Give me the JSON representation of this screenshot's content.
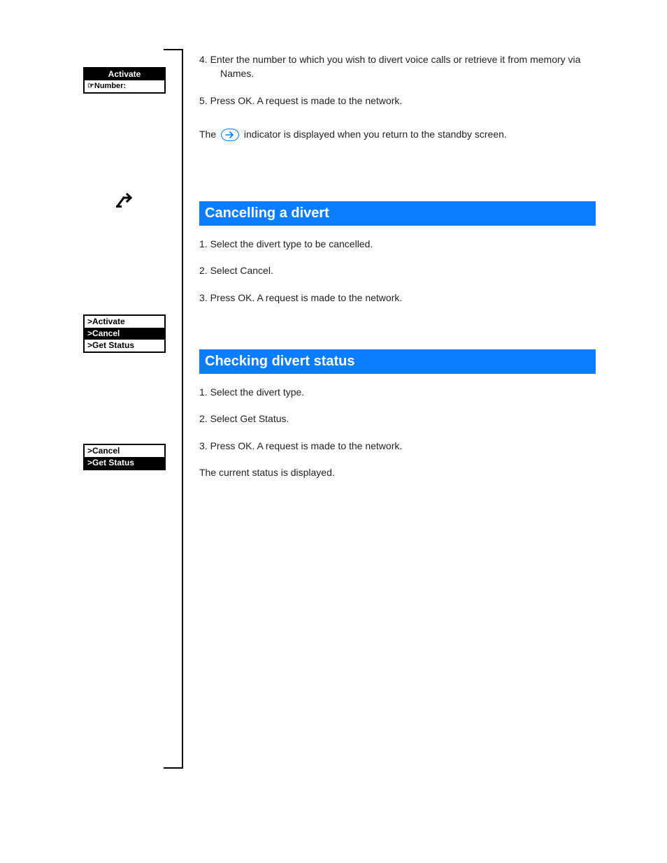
{
  "sidebar": {
    "figA": {
      "row1": "Activate",
      "row2_prefix": "☞",
      "row2": "Number:"
    },
    "divert_glyph": "⤮",
    "figB": {
      "row1": ">Activate",
      "row2": ">Cancel",
      "row3": ">Get Status"
    },
    "figC": {
      "row1": ">Cancel",
      "row2": ">Get Status"
    }
  },
  "steps": {
    "s4": "4.  Enter the number to which you wish to divert voice calls or retrieve it from memory via Names.",
    "s5": "5.  Press OK. A request is made to the network.",
    "indicator_pre": "The ",
    "indicator_post": " indicator is displayed when you return to the standby screen."
  },
  "headings": {
    "cancel": "Cancelling a divert",
    "status": "Checking divert status"
  },
  "cancel": {
    "s1": "1.  Select the divert type to be cancelled.",
    "s2": "2.  Select Cancel.",
    "s3": "3.  Press OK. A request is made to the network."
  },
  "status": {
    "s1": "1.  Select the divert type.",
    "s2": "2.  Select Get Status.",
    "s3": "3.  Press OK. A request is made to the network.",
    "note": "The current status is displayed."
  }
}
